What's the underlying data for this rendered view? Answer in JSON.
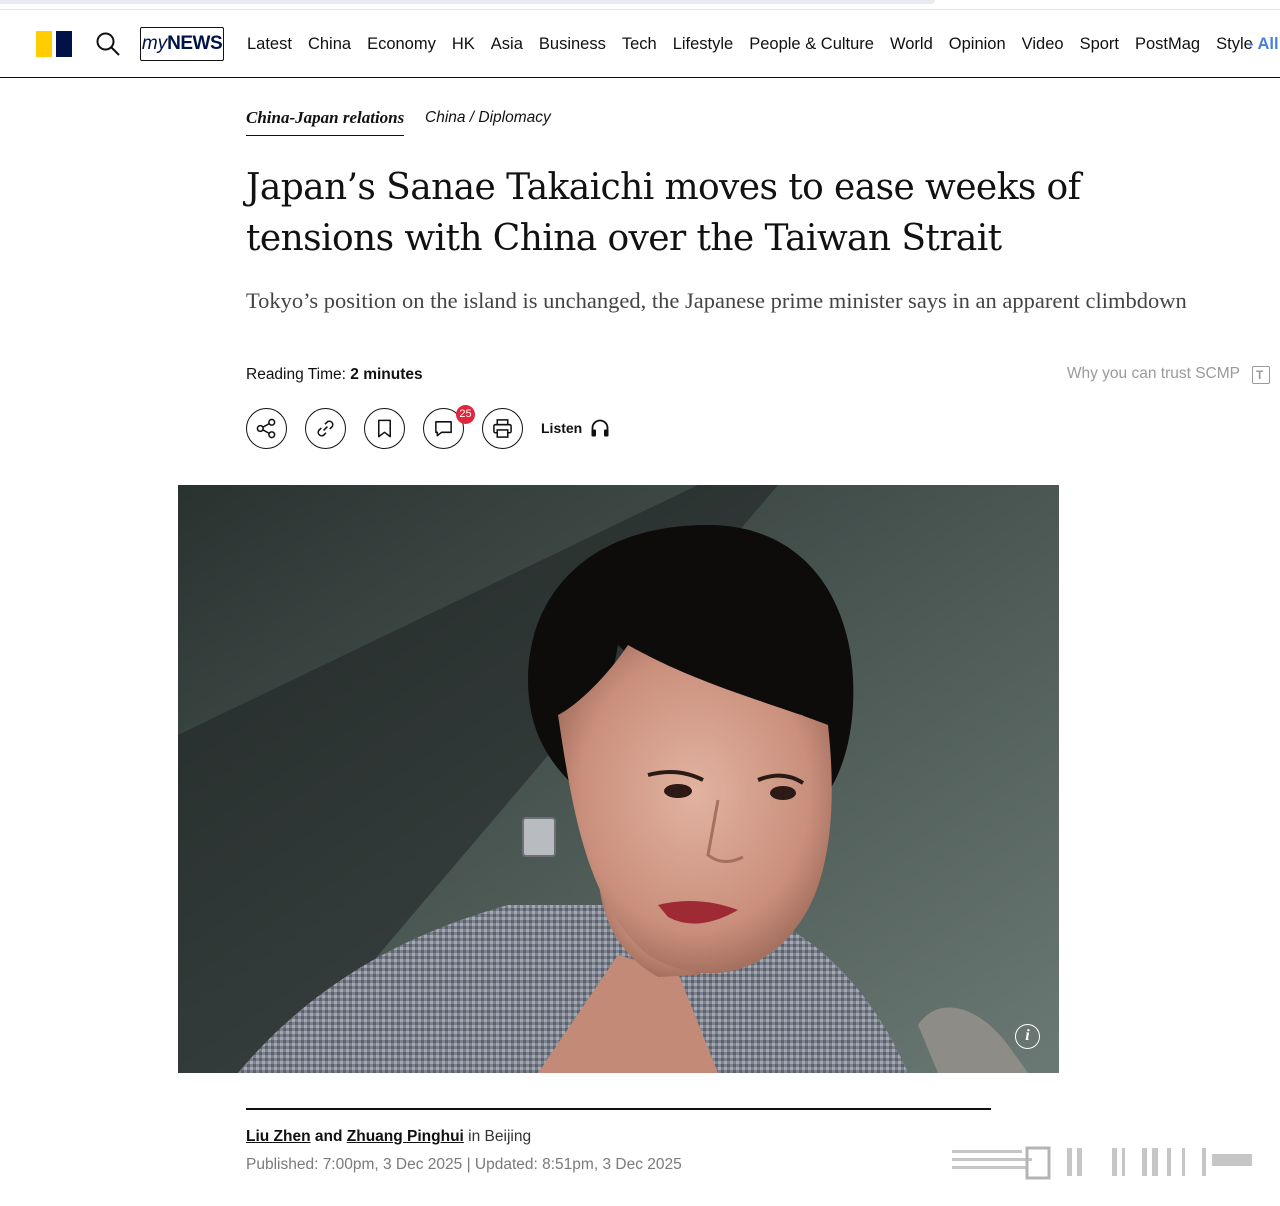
{
  "nav": {
    "items": [
      "Latest",
      "China",
      "Economy",
      "HK",
      "Asia",
      "Business",
      "Tech",
      "Lifestyle",
      "People & Culture",
      "World",
      "Opinion",
      "Video",
      "Sport",
      "PostMag",
      "Style"
    ],
    "all_label": "- All",
    "mynews_my": "my",
    "mynews_news": "NEWS"
  },
  "article": {
    "topic": "China-Japan relations",
    "section": "China / Diplomacy",
    "headline": "Japan’s Sanae Takaichi moves to ease weeks of tensions with China over the Taiwan Strait",
    "subhead": "Tokyo’s position on the island is unchanged, the Japanese prime minister says in an apparent climbdown",
    "reading_label": "Reading Time:",
    "reading_value": "2 minutes",
    "trust_label": "Why you can trust SCMP",
    "comment_count": "25",
    "listen_label": "Listen",
    "image_info": "i"
  },
  "byline": {
    "author1": "Liu Zhen",
    "conj": "and",
    "author2": "Zhuang Pinghui",
    "location": "in Beijing",
    "published": "Published: 7:00pm, 3 Dec 2025 | Updated: 8:51pm, 3 Dec 2025"
  },
  "colors": {
    "logo_yellow": "#ffcd00",
    "logo_navy": "#001246",
    "badge_red": "#e0253c",
    "all_link": "#4a80d8"
  }
}
